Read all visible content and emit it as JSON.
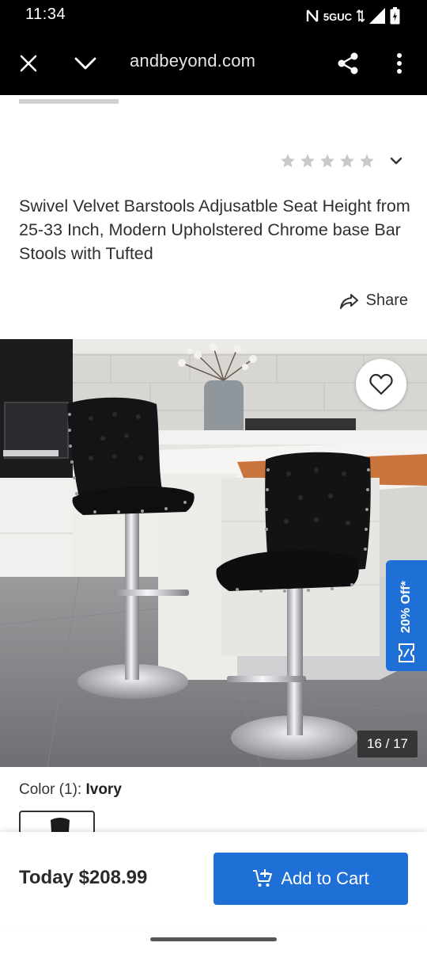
{
  "status_bar": {
    "time": "11:34",
    "network": "5GUC",
    "icons": [
      "nfc-icon",
      "network-arrows-icon",
      "signal-icon",
      "battery-icon"
    ]
  },
  "browser": {
    "url": "andbeyond.com",
    "icons": [
      "close-icon",
      "chevron-down-icon",
      "share-icon",
      "more-vert-icon"
    ]
  },
  "rating": {
    "stars": 5,
    "filled": 0,
    "star_color": "#c9c9c9"
  },
  "product": {
    "title": "Swivel Velvet Barstools Adjusatble Seat Height from 25-33 Inch, Modern Upholstered Chrome base Bar Stools with Tufted",
    "share_label": "Share"
  },
  "gallery": {
    "counter": "16 / 17",
    "promo": "20% Off*"
  },
  "color": {
    "label": "Color (1):",
    "value": "Ivory"
  },
  "cart_bar": {
    "price": "Today $208.99",
    "add_to_cart": "Add to Cart",
    "accent": "#1f70d6"
  }
}
